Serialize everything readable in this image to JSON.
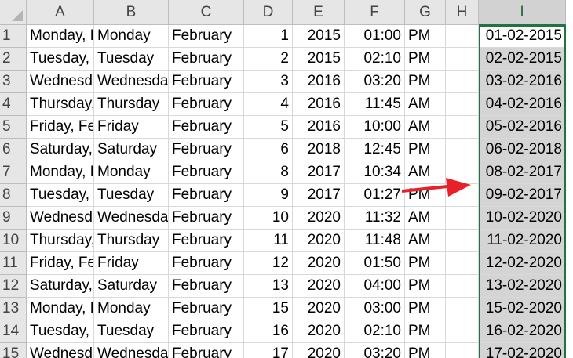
{
  "columns": [
    "A",
    "B",
    "C",
    "D",
    "E",
    "F",
    "G",
    "H",
    "I"
  ],
  "rows": [
    {
      "num": "1",
      "a": "Monday, F",
      "b": "Monday",
      "c": "February",
      "d": "1",
      "e": "2015",
      "f": "01:00",
      "g": "PM",
      "i": "01-02-2015"
    },
    {
      "num": "2",
      "a": "Tuesday, F",
      "b": "Tuesday",
      "c": "February",
      "d": "2",
      "e": "2015",
      "f": "02:10",
      "g": "PM",
      "i": "02-02-2015"
    },
    {
      "num": "3",
      "a": "Wednesda",
      "b": "Wednesday",
      "c": "February",
      "d": "3",
      "e": "2016",
      "f": "03:20",
      "g": "PM",
      "i": "03-02-2016"
    },
    {
      "num": "4",
      "a": "Thursday,",
      "b": "Thursday",
      "c": "February",
      "d": "4",
      "e": "2016",
      "f": "11:45",
      "g": "AM",
      "i": "04-02-2016"
    },
    {
      "num": "5",
      "a": "Friday, Fe",
      "b": "Friday",
      "c": "February",
      "d": "5",
      "e": "2016",
      "f": "10:00",
      "g": "AM",
      "i": "05-02-2016"
    },
    {
      "num": "6",
      "a": "Saturday,",
      "b": "Saturday",
      "c": "February",
      "d": "6",
      "e": "2018",
      "f": "12:45",
      "g": "PM",
      "i": "06-02-2018"
    },
    {
      "num": "7",
      "a": "Monday, F",
      "b": "Monday",
      "c": "February",
      "d": "8",
      "e": "2017",
      "f": "10:34",
      "g": "AM",
      "i": "08-02-2017"
    },
    {
      "num": "8",
      "a": "Tuesday, F",
      "b": "Tuesday",
      "c": "February",
      "d": "9",
      "e": "2017",
      "f": "01:27",
      "g": "PM",
      "i": "09-02-2017"
    },
    {
      "num": "9",
      "a": "Wednesda",
      "b": "Wednesday",
      "c": "February",
      "d": "10",
      "e": "2020",
      "f": "11:32",
      "g": "AM",
      "i": "10-02-2020"
    },
    {
      "num": "10",
      "a": "Thursday,",
      "b": "Thursday",
      "c": "February",
      "d": "11",
      "e": "2020",
      "f": "11:48",
      "g": "AM",
      "i": "11-02-2020"
    },
    {
      "num": "11",
      "a": "Friday, Fe",
      "b": "Friday",
      "c": "February",
      "d": "12",
      "e": "2020",
      "f": "01:50",
      "g": "PM",
      "i": "12-02-2020"
    },
    {
      "num": "12",
      "a": "Saturday,",
      "b": "Saturday",
      "c": "February",
      "d": "13",
      "e": "2020",
      "f": "04:00",
      "g": "PM",
      "i": "13-02-2020"
    },
    {
      "num": "13",
      "a": "Monday, F",
      "b": "Monday",
      "c": "February",
      "d": "15",
      "e": "2020",
      "f": "03:00",
      "g": "PM",
      "i": "15-02-2020"
    },
    {
      "num": "14",
      "a": "Tuesday, F",
      "b": "Tuesday",
      "c": "February",
      "d": "16",
      "e": "2020",
      "f": "02:10",
      "g": "PM",
      "i": "16-02-2020"
    },
    {
      "num": "15",
      "a": "Wednesda",
      "b": "Wednesda",
      "c": "February",
      "d": "17",
      "e": "2020",
      "f": "03:20",
      "g": "PM",
      "i": "17-02-2020"
    }
  ],
  "selected_column": "I",
  "colors": {
    "selection": "#217346",
    "arrow": "#e8202a",
    "selected_fill": "#d4d4d4"
  },
  "annotation": {
    "icon": "red-arrow-icon"
  }
}
